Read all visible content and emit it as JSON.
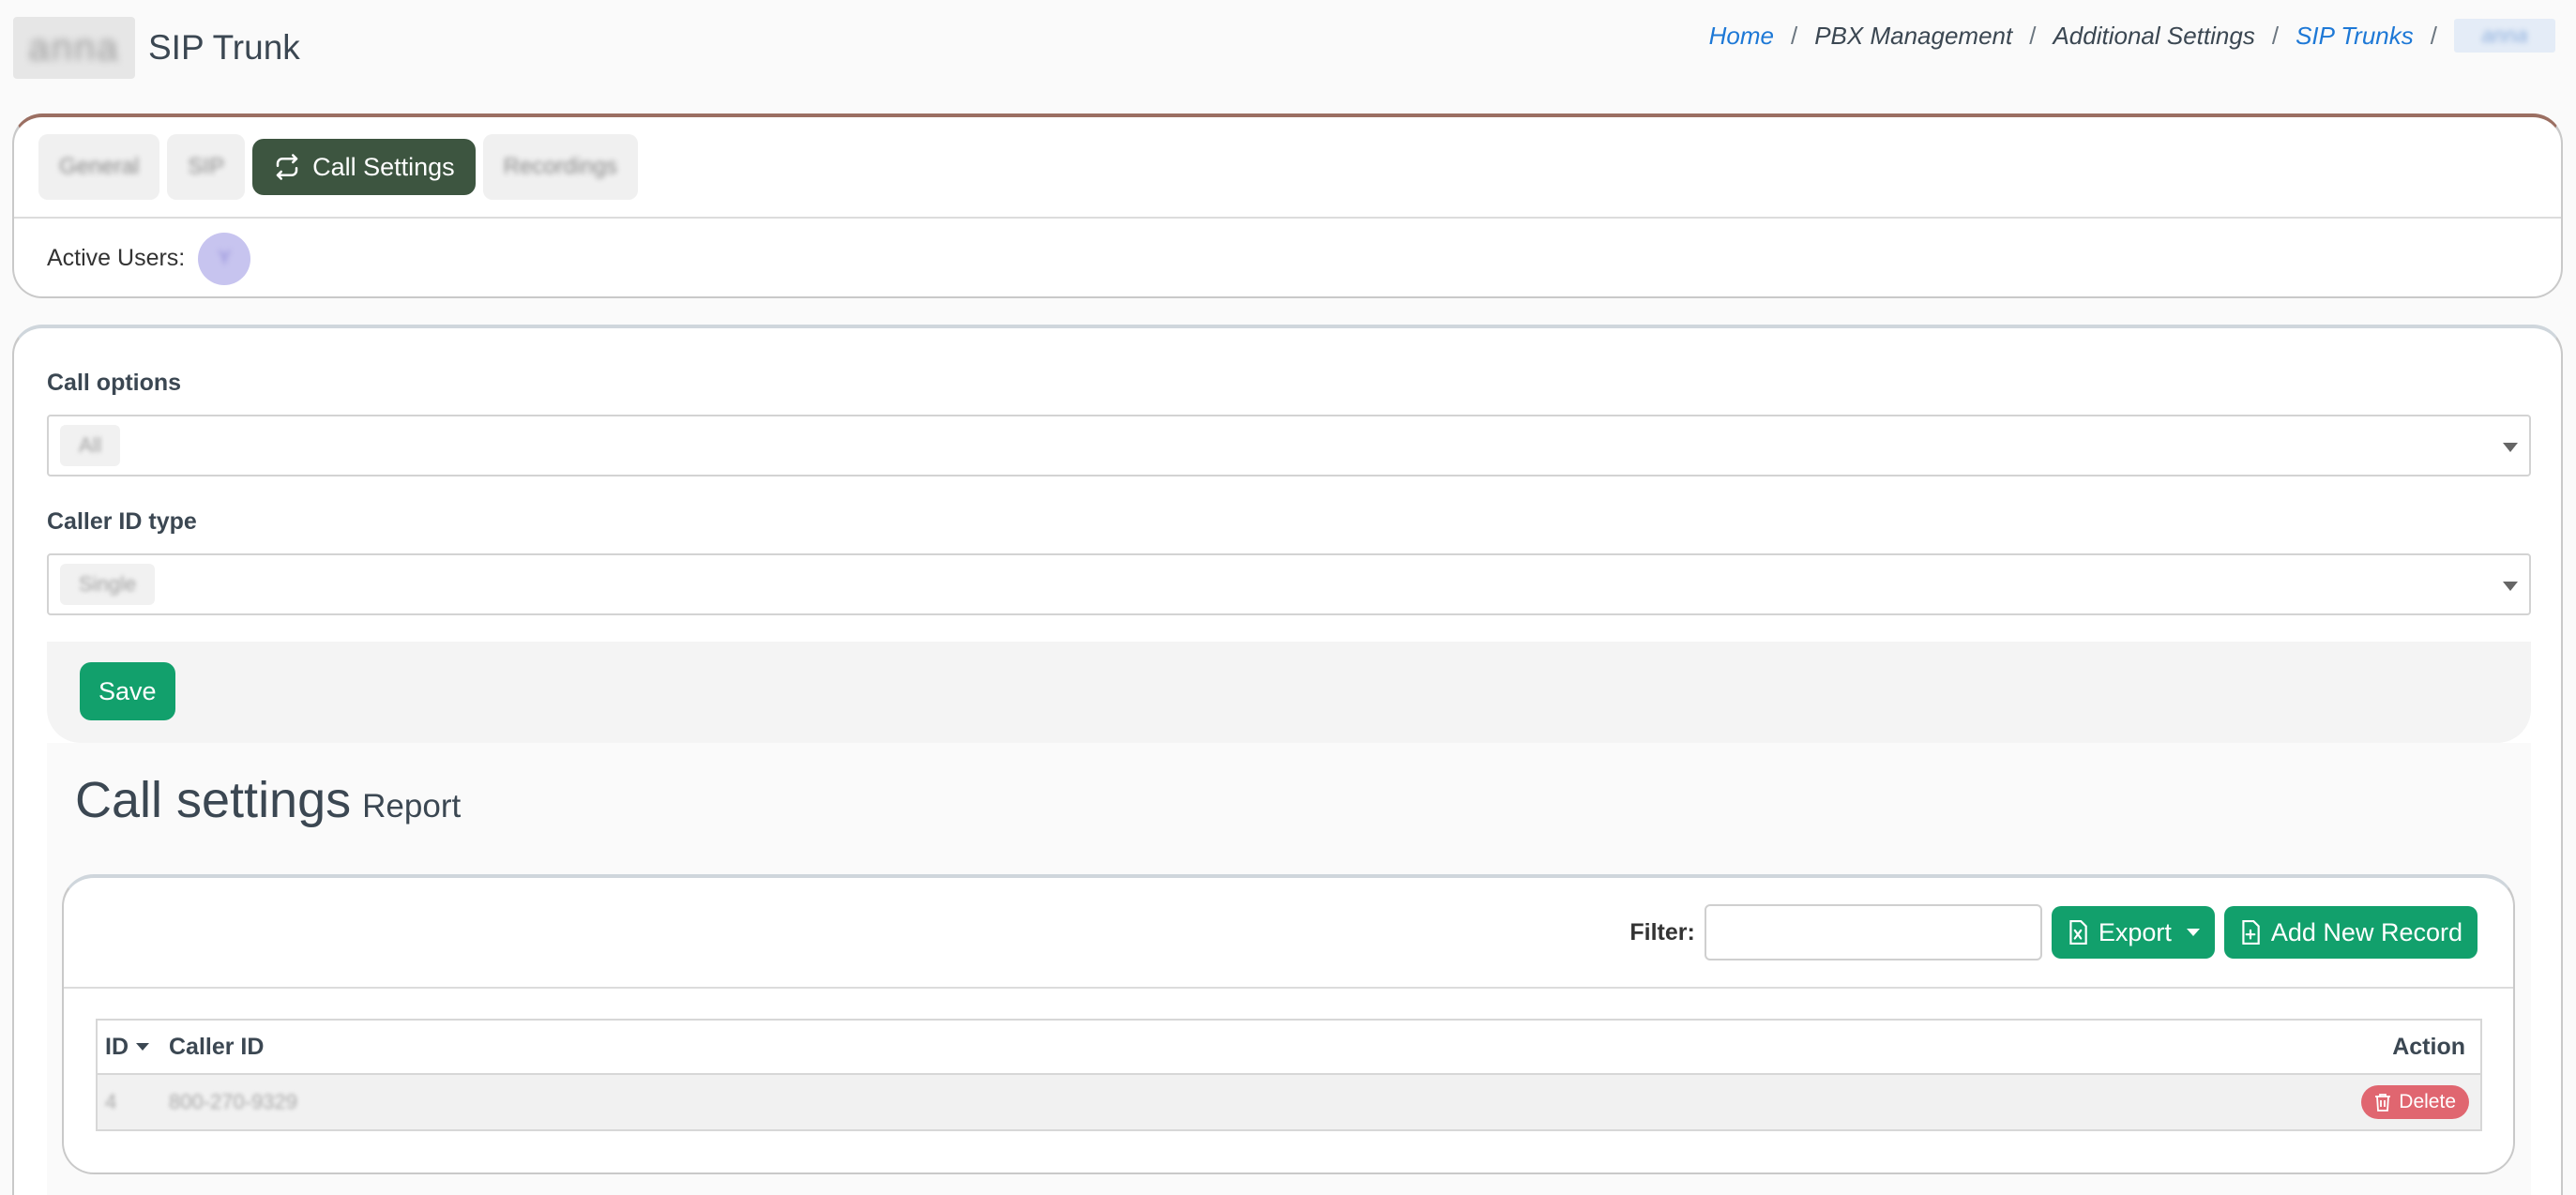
{
  "header": {
    "logo_text": "anna",
    "title": "SIP Trunk"
  },
  "breadcrumb": {
    "items": [
      "Home",
      "PBX Management",
      "Additional Settings",
      "SIP Trunks"
    ],
    "current": "anna"
  },
  "tabs": {
    "general": "General",
    "sip": "SIP",
    "call_settings": "Call Settings",
    "recordings": "Recordings"
  },
  "active_users": {
    "label": "Active Users:",
    "avatar_initial": "Y"
  },
  "form": {
    "call_options_label": "Call options",
    "call_options_value": "All",
    "caller_id_type_label": "Caller ID type",
    "caller_id_type_value": "Single",
    "save_label": "Save"
  },
  "report": {
    "title": "Call settings",
    "subtitle": "Report",
    "filter_label": "Filter:",
    "filter_value": "",
    "export_label": "Export",
    "add_label": "Add New Record",
    "columns": {
      "id": "ID",
      "caller_id": "Caller ID",
      "action": "Action"
    },
    "rows": [
      {
        "id": "4",
        "caller_id": "800-270-9329",
        "action": "Delete"
      }
    ]
  },
  "colors": {
    "accent_green": "#12a06c",
    "tab_active": "#3d5540",
    "delete_red": "#e06670",
    "link_blue": "#1d78d6",
    "card_top_border": "#9b6f62"
  }
}
